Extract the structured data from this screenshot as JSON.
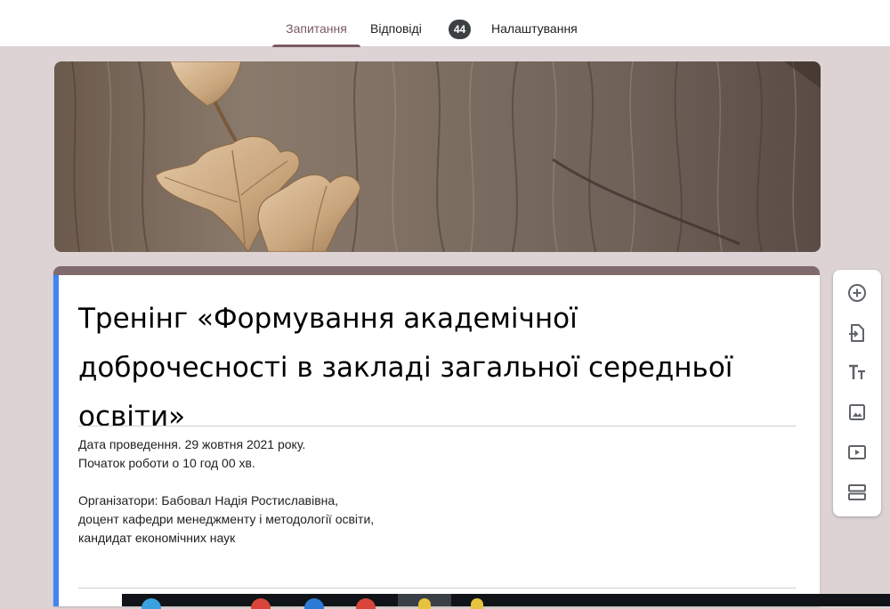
{
  "tabs": {
    "questions": "Запитання",
    "responses": "Відповіді",
    "responses_count": "44",
    "settings": "Налаштування"
  },
  "form": {
    "title": "Тренінг «Формування академічної доброчесності  в закладі загальної середньої освіти»",
    "description": [
      "Дата проведення. 29 жовтня 2021 року.",
      "Початок роботи о 10 год 00 хв.",
      "",
      "Організатори: Бабовал Надія Ростиславівна,",
      "доцент кафедри менеджменту і методології освіти,",
      "кандидат економічних наук"
    ]
  },
  "toolbar": {
    "icons": [
      "add-question-icon",
      "import-questions-icon",
      "add-title-icon",
      "add-image-icon",
      "add-video-icon",
      "add-section-icon"
    ]
  },
  "colors": {
    "theme": "#7f6a6e",
    "accent_bar": "#4285f4",
    "background": "#ddd3d4",
    "badge": "#3c4043"
  }
}
